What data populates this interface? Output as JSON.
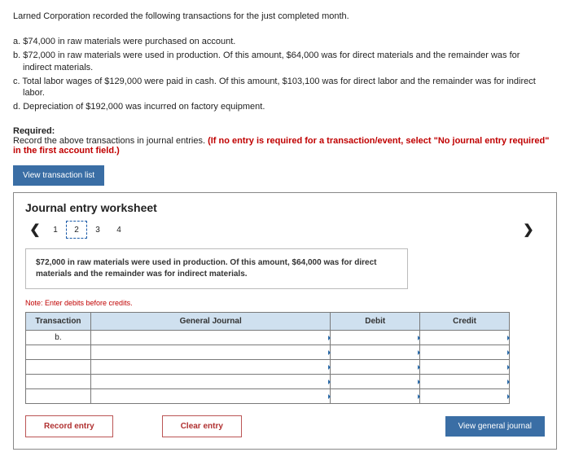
{
  "intro": "Larned Corporation recorded the following transactions for the just completed month.",
  "items": {
    "a": "a. $74,000 in raw materials were purchased on account.",
    "b_line1": "b. $72,000 in raw materials were used in production. Of this amount, $64,000 was for direct materials and the remainder was for",
    "b_line2": "indirect materials.",
    "c_line1": "c. Total labor wages of $129,000 were paid in cash. Of this amount, $103,100 was for direct labor and the remainder was for indirect",
    "c_line2": "labor.",
    "d": "d. Depreciation of $192,000 was incurred on factory equipment."
  },
  "required": {
    "label": "Required:",
    "text_plain": "Record the above transactions in journal entries. ",
    "text_red": "(If no entry is required for a transaction/event, select \"No journal entry required\" in the first account field.)"
  },
  "buttons": {
    "view_list": "View transaction list",
    "record": "Record entry",
    "clear": "Clear entry",
    "view_journal": "View general journal"
  },
  "worksheet": {
    "title": "Journal entry worksheet",
    "pages": [
      "1",
      "2",
      "3",
      "4"
    ],
    "active_page_index": 1,
    "description": "$72,000 in raw materials were used in production. Of this amount, $64,000 was for direct materials and the remainder was for indirect materials.",
    "note": "Note: Enter debits before credits.",
    "headers": {
      "transaction": "Transaction",
      "general_journal": "General Journal",
      "debit": "Debit",
      "credit": "Credit"
    },
    "first_row_label": "b."
  }
}
